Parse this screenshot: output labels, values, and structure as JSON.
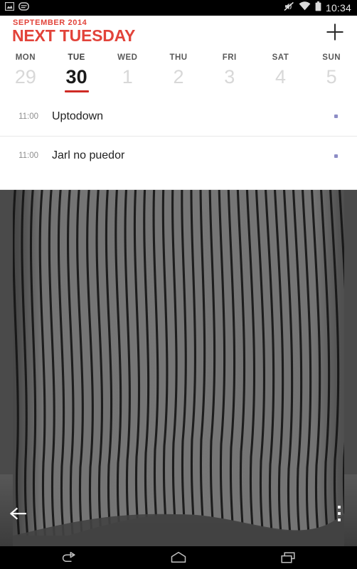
{
  "status_bar": {
    "left_icons": [
      {
        "name": "screenshot-icon",
        "label": "screenshot"
      },
      {
        "name": "message-icon",
        "label": "message"
      }
    ],
    "right_icons": [
      {
        "name": "volume-mute-icon",
        "label": "silent"
      },
      {
        "name": "wifi-icon",
        "label": "wifi"
      },
      {
        "name": "battery-icon",
        "label": "battery"
      }
    ],
    "clock": "10:34",
    "background": "#000000"
  },
  "header": {
    "month_year": "SEPTEMBER 2014",
    "title": "NEXT TUESDAY",
    "accent_color": "#e2433a",
    "add_button_label": "+"
  },
  "week_strip": {
    "selected_index": 1,
    "underline_color": "#cf2b25",
    "days": [
      {
        "dow": "MON",
        "num": "29",
        "selected": false
      },
      {
        "dow": "TUE",
        "num": "30",
        "selected": true
      },
      {
        "dow": "WED",
        "num": "1",
        "selected": false
      },
      {
        "dow": "THU",
        "num": "2",
        "selected": false
      },
      {
        "dow": "FRI",
        "num": "3",
        "selected": false
      },
      {
        "dow": "SAT",
        "num": "4",
        "selected": false
      },
      {
        "dow": "SUN",
        "num": "5",
        "selected": false
      }
    ]
  },
  "events": [
    {
      "time": "11:00",
      "title": "Uptodown",
      "dot_color": "#8d8dc6"
    },
    {
      "time": "11:00",
      "title": "Jarl no puedor",
      "dot_color": "#8d8dc6"
    }
  ],
  "wallpaper": {
    "description": "gray background with black wavy vertical stripes",
    "background_color": "#4d4d4d",
    "stripe_color": "#0d0d0d",
    "back_button": {
      "name": "back-arrow-icon",
      "label": "Back"
    },
    "overflow_button": {
      "name": "overflow-menu-icon",
      "label": "More options"
    }
  },
  "nav_bar": {
    "buttons": [
      {
        "name": "nav-back-icon",
        "label": "Back"
      },
      {
        "name": "nav-home-icon",
        "label": "Home"
      },
      {
        "name": "nav-recents-icon",
        "label": "Recent apps"
      }
    ],
    "background": "#000000"
  }
}
